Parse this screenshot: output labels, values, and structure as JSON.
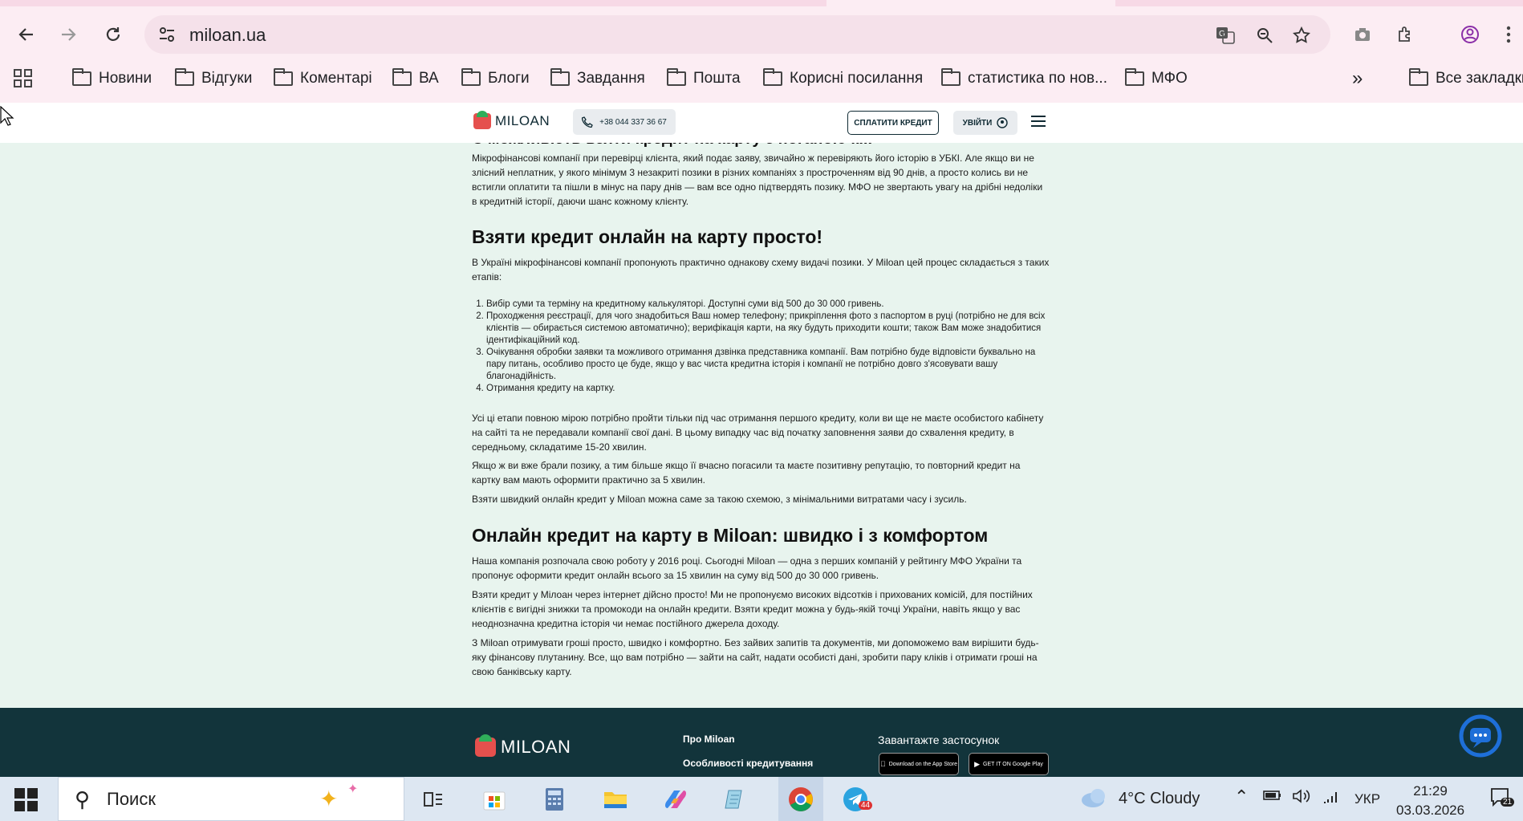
{
  "browser": {
    "url": "miloan.ua",
    "bookmarks": [
      "Новини",
      "Відгуки",
      "Коментарі",
      "ВА",
      "Блоги",
      "Завдання",
      "Пошта",
      "Корисні посилання",
      "статистика по нов...",
      "МФО"
    ],
    "all_bookmarks": "Все закладки",
    "more": "»"
  },
  "site": {
    "logo": "MILOAN",
    "phone": "+38 044 337 36 67",
    "pay_button": "СПЛАТИТИ КРЕДИТ",
    "login_button": "УВІЙТИ"
  },
  "article": {
    "partial_heading": "Є можливість взяти кредит на карту з поганою к...",
    "p0": "Мікрофінансові компанії при перевірці клієнта, який подає заяву, звичайно ж перевіряють його історію в УБКІ. Але якщо ви не злісний неплатник, у якого мінімум 3 незакриті позики в різних компаніях з простроченням від 90 днів, а просто колись ви не встигли оплатити та пішли в мінус на пару днів — вам все одно підтвердять позику. МФО не звертають увагу на дрібні недоліки в кредитній історії, даючи шанс кожному клієнту.",
    "h1": "Взяти кредит онлайн на карту просто!",
    "p1": "В Україні мікрофінансові компанії пропонують практично однакову схему видачі позики. У Miloan цей процес складається з таких етапів:",
    "steps": [
      "Вибір суми та терміну на кредитному калькуляторі. Доступні суми від 500 до 30 000 гривень.",
      "Проходження реєстрації, для чого знадобиться Ваш номер телефону; прикріплення фото з паспортом в руці (потрібно не для всіх клієнтів — обирається системою автоматично); верифікація карти, на яку будуть приходити кошти; також Вам може знадобитися ідентифікаційний код.",
      "Очікування обробки заявки та можливого отримання дзвінка представника компанії. Вам потрібно буде відповісти буквально на пару питань, особливо просто це буде, якщо у вас чиста кредитна історія і компанії не потрібно довго з'ясовувати вашу благонадійність.",
      "Отримання кредиту на картку."
    ],
    "p2": "Усі ці етапи повною мірою потрібно пройти тільки під час отримання першого кредиту, коли ви ще не маєте особистого кабінету на сайті та не передавали компанії свої дані. В цьому випадку час від початку заповнення заяви до схвалення кредиту, в середньому, складатиме 15-20 хвилин.",
    "p3": "Якщо ж ви вже брали позику, а тим більше якщо її вчасно погасили та маєте позитивну репутацію, то повторний кредит на картку вам мають оформити практично за 5 хвилин.",
    "p4": "Взяти швидкий онлайн кредит у Miloan можна саме за такою схемою, з мінімальними витратами часу і зусиль.",
    "h2": "Онлайн кредит на карту в Miloan: швидко і з комфортом",
    "p5": "Наша компанія розпочала свою роботу у 2016 році. Сьогодні Miloan — одна з перших компаній у рейтингу МФО України та пропонує оформити кредит онлайн всього за 15 хвилин на суму від 500 до 30 000 гривень.",
    "p6": "Взяти кредит у Мілоан через інтернет дійсно просто! Ми не пропонуємо високих відсотків і прихованих комісій, для постійних клієнтів є вигідні знижки та промокоди на онлайн кредити. Взяти кредит можна у будь-якій точці України, навіть якщо у вас неоднозначна кредитна історія чи немає постійного джерела доходу.",
    "p7": "З Miloan отримувати гроші просто, швидко і комфортно. Без зайвих запитів та документів, ми допоможемо вам вирішити будь-яку фінансову плутанину. Все, що вам потрібно — зайти на сайт, надати особисті дані, зробити пару кліків і отримати гроші на свою банківську карту."
  },
  "footer": {
    "logo": "MILOAN",
    "link1": "Про Miloan",
    "link2": "Особливості кредитування",
    "app_title": "Завантажте застосунок",
    "app_store": "Download on the App Store",
    "google_play": "GET IT ON Google Play"
  },
  "taskbar": {
    "search_placeholder": "Поиск",
    "weather": "4°C  Cloudy",
    "lang": "УКР",
    "time": "21:29",
    "date": "03.03.2026",
    "telegram_badge": "44",
    "notif_badge": "21"
  }
}
